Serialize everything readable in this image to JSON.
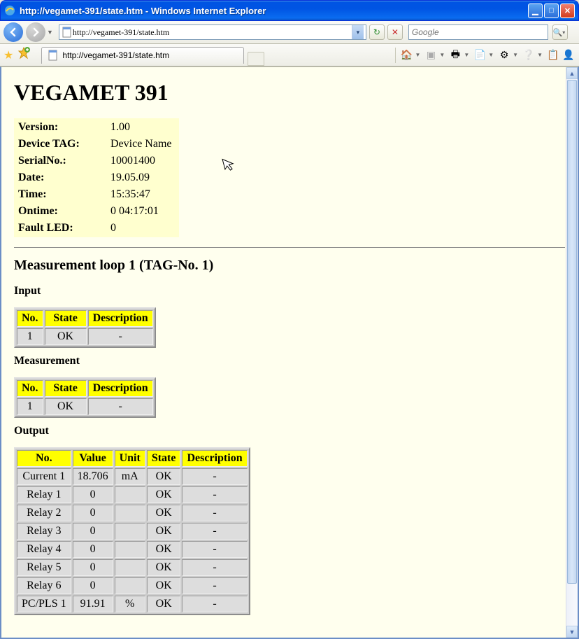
{
  "window": {
    "title": "http://vegamet-391/state.htm - Windows Internet Explorer",
    "url": "http://vegamet-391/state.htm",
    "tab_title": "http://vegamet-391/state.htm",
    "search_placeholder": "Google"
  },
  "page": {
    "heading": "VEGAMET 391",
    "info": {
      "version_label": "Version:",
      "version": "1.00",
      "tag_label": "Device TAG:",
      "tag": "Device Name",
      "serial_label": "SerialNo.:",
      "serial": "10001400",
      "date_label": "Date:",
      "date": "19.05.09",
      "time_label": "Time:",
      "time": "15:35:47",
      "ontime_label": "Ontime:",
      "ontime": "0 04:17:01",
      "fault_label": "Fault LED:",
      "fault": "0"
    },
    "loop_heading": "Measurement loop 1 (TAG-No. 1)",
    "sections": {
      "input": {
        "label": "Input",
        "headers": {
          "no": "No.",
          "state": "State",
          "description": "Description"
        },
        "rows": [
          {
            "no": "1",
            "state": "OK",
            "desc": "-"
          }
        ]
      },
      "measurement": {
        "label": "Measurement",
        "headers": {
          "no": "No.",
          "state": "State",
          "description": "Description"
        },
        "rows": [
          {
            "no": "1",
            "state": "OK",
            "desc": "-"
          }
        ]
      },
      "output": {
        "label": "Output",
        "headers": {
          "no": "No.",
          "value": "Value",
          "unit": "Unit",
          "state": "State",
          "description": "Description"
        },
        "rows": [
          {
            "no": "Current 1",
            "value": "18.706",
            "unit": "mA",
            "state": "OK",
            "desc": "-"
          },
          {
            "no": "Relay 1",
            "value": "0",
            "unit": "",
            "state": "OK",
            "desc": "-"
          },
          {
            "no": "Relay 2",
            "value": "0",
            "unit": "",
            "state": "OK",
            "desc": "-"
          },
          {
            "no": "Relay 3",
            "value": "0",
            "unit": "",
            "state": "OK",
            "desc": "-"
          },
          {
            "no": "Relay 4",
            "value": "0",
            "unit": "",
            "state": "OK",
            "desc": "-"
          },
          {
            "no": "Relay 5",
            "value": "0",
            "unit": "",
            "state": "OK",
            "desc": "-"
          },
          {
            "no": "Relay 6",
            "value": "0",
            "unit": "",
            "state": "OK",
            "desc": "-"
          },
          {
            "no": "PC/PLS 1",
            "value": "91.91",
            "unit": "%",
            "state": "OK",
            "desc": "-"
          }
        ]
      }
    }
  }
}
